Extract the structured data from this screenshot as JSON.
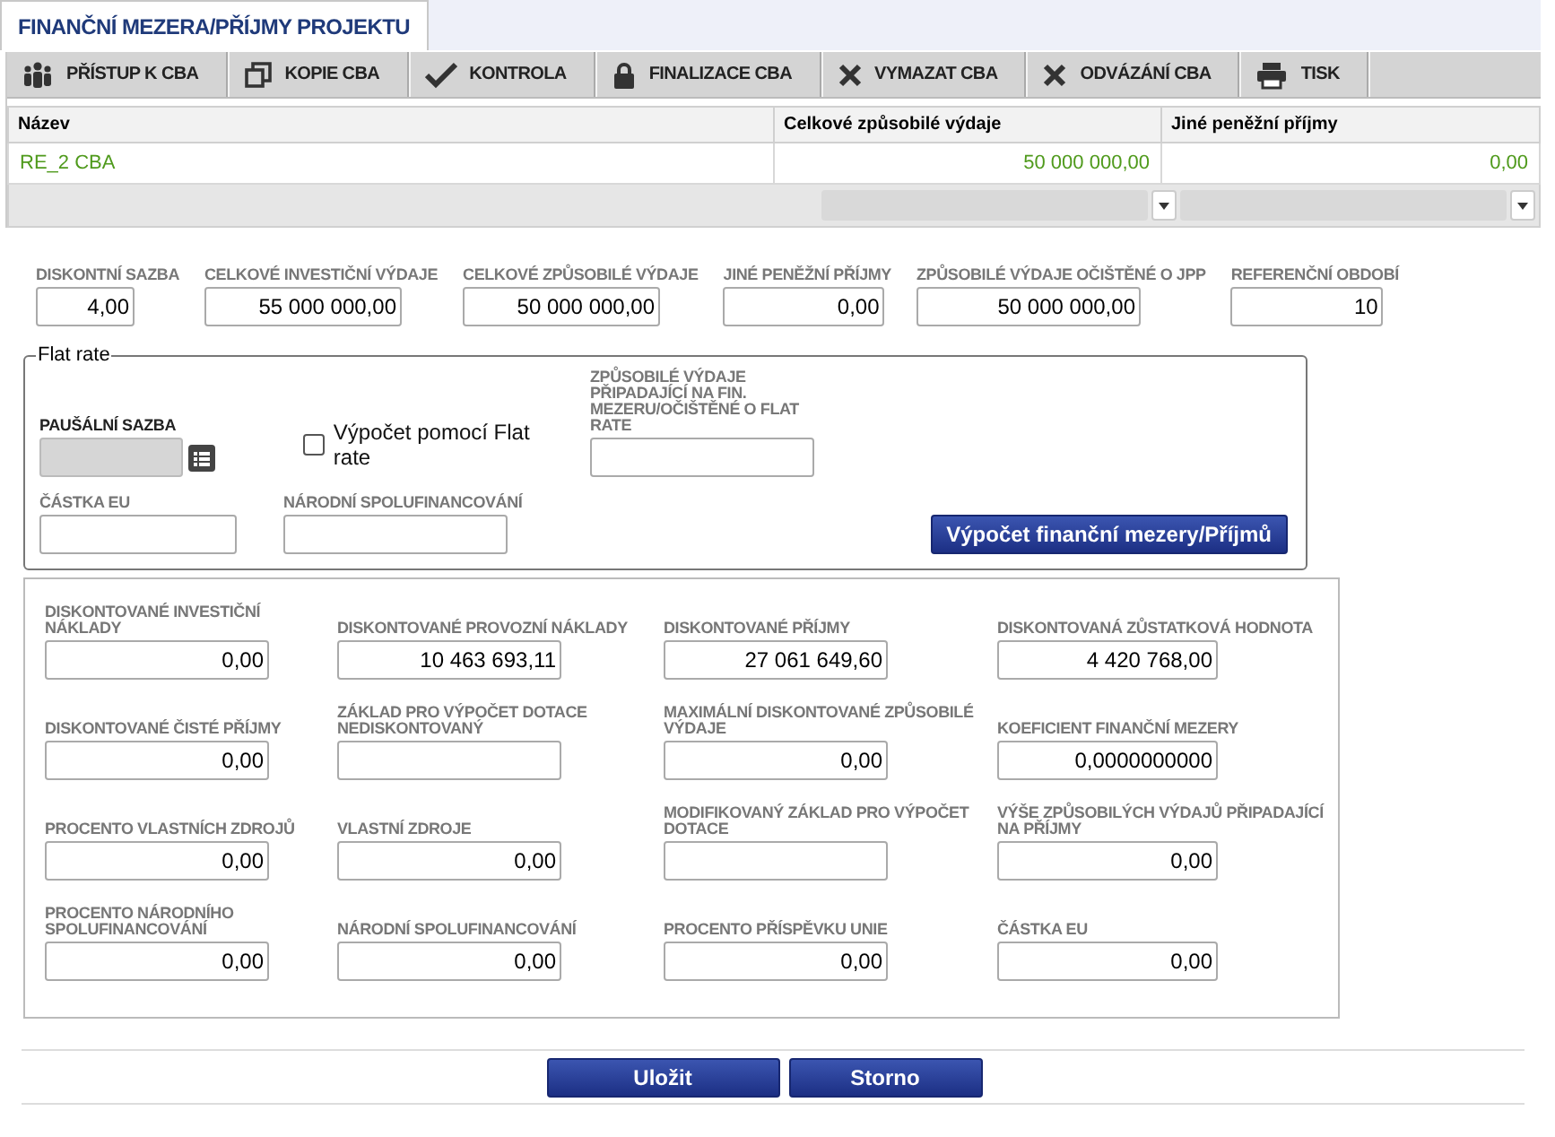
{
  "tab": {
    "label": "FINANČNÍ MEZERA/PŘÍJMY PROJEKTU",
    "selected": true
  },
  "toolbar": [
    "PŘÍSTUP K CBA",
    "KOPIE CBA",
    "KONTROLA",
    "FINALIZACE CBA",
    "VYMAZAT CBA",
    "ODVÁZÁNÍ CBA",
    "TISK"
  ],
  "table": {
    "columns": [
      "Název",
      "Celkové způsobilé výdaje",
      "Jiné peněžní příjmy"
    ],
    "rows": [
      {
        "cells": [
          "RE_2 CBA",
          "50 000 000,00",
          "0,00"
        ]
      }
    ]
  },
  "top_fields": [
    {
      "label": "DISKONTNÍ SAZBA",
      "value": "4,00"
    },
    {
      "label": "CELKOVÉ INVESTIČNÍ VÝDAJE",
      "value": "55 000 000,00"
    },
    {
      "label": "CELKOVÉ ZPŮSOBILÉ VÝDAJE",
      "value": "50 000 000,00"
    },
    {
      "label": "JINÉ PENĚŽNÍ PŘÍJMY",
      "value": "0,00"
    },
    {
      "label": "ZPŮSOBILÉ VÝDAJE OČIŠTĚNÉ O JPP",
      "value": "50 000 000,00"
    },
    {
      "label": "REFERENČNÍ OBDOBÍ",
      "value": "10"
    }
  ],
  "flat_rate": {
    "legend": "Flat rate",
    "rate": {
      "label": "PAUŠÁLNÍ SAZBA",
      "mandatory": true,
      "disabled": true
    },
    "checkbox": {
      "label": "Výpočet pomocí Flat rate",
      "checked": false
    },
    "adjusted": {
      "label": "ZPŮSOBILÉ VÝDAJE PŘIPADAJÍCÍ NA FIN. MEZERU/OČIŠTĚNÉ O FLAT RATE",
      "mandatory": false,
      "disabled": false
    },
    "eu": {
      "label": "ČÁSTKA EU",
      "mandatory": false,
      "disabled": false
    },
    "national": {
      "label": "NÁRODNÍ SPOLUFINANCOVÁNÍ",
      "mandatory": false,
      "disabled": false
    },
    "button": "Výpočet finanční mezery/Příjmů"
  },
  "results": [
    {
      "label": "DISKONTOVANÉ INVESTIČNÍ NÁKLADY",
      "value": "0,00"
    },
    {
      "label": "DISKONTOVANÉ PROVOZNÍ NÁKLADY",
      "value": "10 463 693,11"
    },
    {
      "label": "DISKONTOVANÉ PŘÍJMY",
      "value": "27 061 649,60"
    },
    {
      "label": "DISKONTOVANÁ ZŮSTATKOVÁ HODNOTA",
      "value": "4 420 768,00"
    },
    {
      "label": "DISKONTOVANÉ ČISTÉ PŘÍJMY",
      "value": "0,00"
    },
    {
      "label": "ZÁKLAD PRO VÝPOČET DOTACE NEDISKONTOVANÝ"
    },
    {
      "label": "MAXIMÁLNÍ DISKONTOVANÉ ZPŮSOBILÉ VÝDAJE",
      "value": "0,00"
    },
    {
      "label": "KOEFICIENT FINANČNÍ MEZERY",
      "value": "0,0000000000"
    },
    {
      "label": "PROCENTO VLASTNÍCH ZDROJŮ",
      "value": "0,00"
    },
    {
      "label": "VLASTNÍ ZDROJE",
      "value": "0,00"
    },
    {
      "label": "MODIFIKOVANÝ ZÁKLAD PRO VÝPOČET DOTACE"
    },
    {
      "label": "VÝŠE ZPŮSOBILÝCH VÝDAJŮ PŘIPADAJÍCÍ NA PŘÍJMY",
      "value": "0,00"
    },
    {
      "label": "PROCENTO NÁRODNÍHO SPOLUFINANCOVÁNÍ",
      "value": "0,00"
    },
    {
      "label": "NÁRODNÍ SPOLUFINANCOVÁNÍ",
      "value": "0,00"
    },
    {
      "label": "PROCENTO PŘÍSPĚVKU UNIE",
      "value": "0,00"
    },
    {
      "label": "ČÁSTKA EU",
      "value": "0,00"
    }
  ],
  "buttons": [
    "Uložit",
    "Storno"
  ]
}
